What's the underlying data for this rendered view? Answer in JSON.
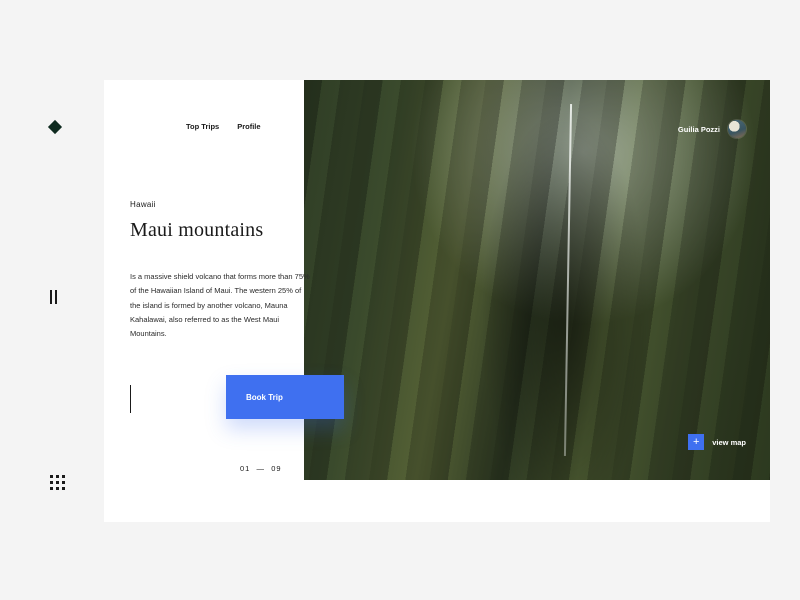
{
  "nav": {
    "top_trips": "Top Trips",
    "profile": "Profile"
  },
  "user": {
    "name": "Guilia Pozzi"
  },
  "destination": {
    "eyebrow": "Hawaii",
    "title": "Maui mountains",
    "description": "Is a massive shield volcano that forms more than 75% of the Hawaiian Island of Maui. The western 25% of the island is formed by another volcano, Mauna Kahalawai, also referred to as the West Maui Mountains."
  },
  "cta": {
    "book": "Book Trip"
  },
  "map": {
    "plus": "+",
    "label": "view map"
  },
  "pager": {
    "current": "01",
    "sep": "—",
    "total": "09"
  },
  "colors": {
    "accent": "#3f70f0"
  }
}
